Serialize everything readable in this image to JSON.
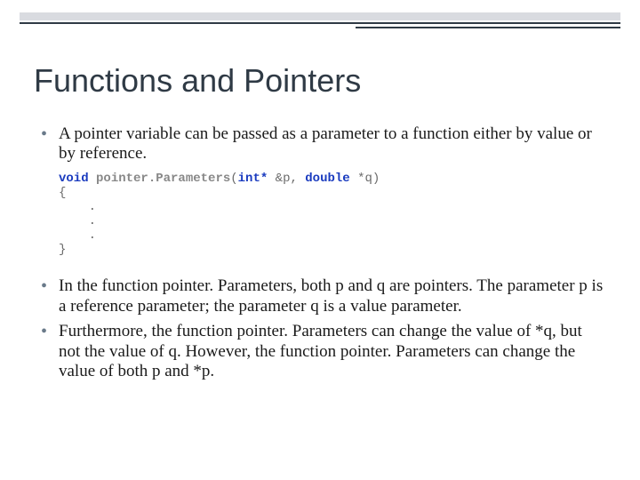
{
  "slide": {
    "title": "Functions and Pointers",
    "bullets": [
      "A pointer variable can be passed as a parameter to a function either by value or by reference.",
      "In the function pointer. Parameters, both p and q are pointers. The parameter p is a reference parameter; the parameter q is a value parameter.",
      " Furthermore, the function pointer. Parameters can change the value of *q, but not the value of q. However, the function pointer. Parameters can change the value of both p and *p."
    ],
    "code": {
      "kw_void": "void",
      "fn_name": "pointer.Parameters",
      "open_paren": "(",
      "kw_int_ptr": "int*",
      "amp_p": " &p, ",
      "kw_double": "double",
      "star_q": " *q)",
      "brace_open": "{",
      "dot": ".",
      "brace_close": "}"
    }
  }
}
